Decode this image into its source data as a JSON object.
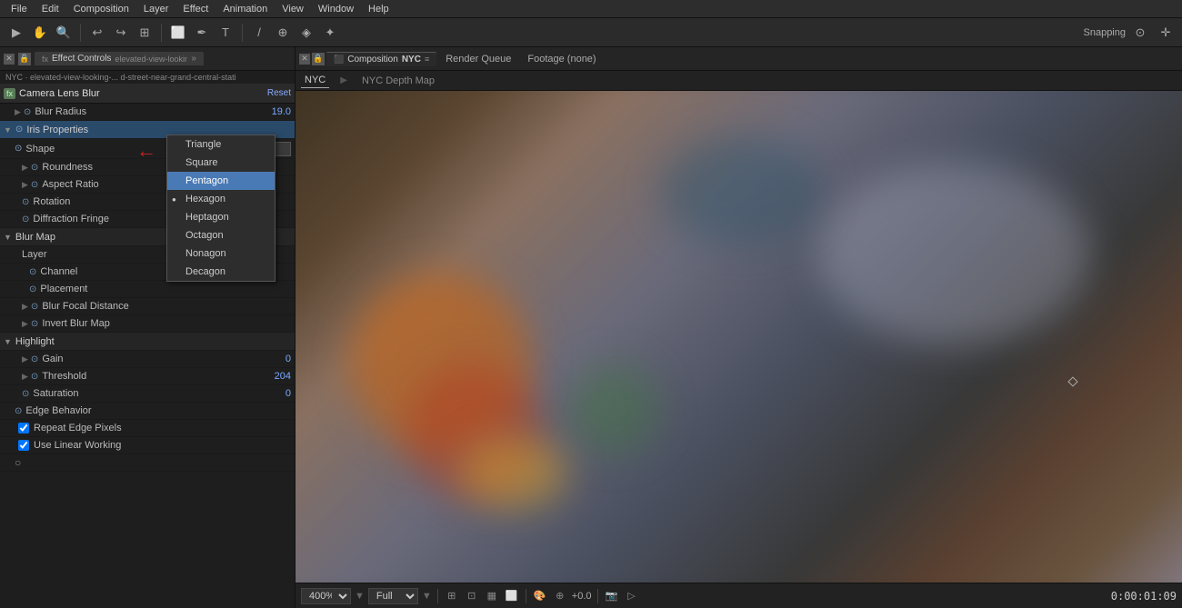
{
  "menubar": {
    "items": [
      "File",
      "Edit",
      "Composition",
      "Layer",
      "Effect",
      "Animation",
      "View",
      "Window",
      "Help"
    ]
  },
  "toolbar": {
    "snapping_label": "Snapping"
  },
  "left_panel": {
    "tab_label": "Effect Controls",
    "tab_file": "elevated-view-looking-... d-st",
    "layer_path": "NYC · elevated-view-looking-... d-street-near-grand-central-stati",
    "effect": {
      "name": "Camera Lens Blur",
      "reset_label": "Reset",
      "blur_radius_label": "Blur Radius",
      "blur_radius_value": "19.0",
      "iris_properties_label": "Iris Properties",
      "shape_label": "Shape",
      "shape_value": "Hexagon",
      "shape_options": [
        "Triangle",
        "Square",
        "Pentagon",
        "Hexagon",
        "Heptagon",
        "Octagon",
        "Nonagon",
        "Decagon"
      ],
      "shape_selected": "Hexagon",
      "shape_highlighted": "Pentagon",
      "roundness_label": "Roundness",
      "aspect_ratio_label": "Aspect Ratio",
      "rotation_label": "Rotation",
      "diffraction_fringe_label": "Diffraction Fringe",
      "blur_map_label": "Blur Map",
      "layer_label": "Layer",
      "channel_label": "Channel",
      "placement_label": "Placement",
      "blur_focal_distance_label": "Blur Focal Distance",
      "invert_blur_map_label": "Invert Blur Map",
      "highlight_label": "Highlight",
      "gain_label": "Gain",
      "gain_value": "0",
      "threshold_label": "Threshold",
      "threshold_value": "204",
      "saturation_label": "Saturation",
      "saturation_value": "0",
      "edge_behavior_label": "Edge Behavior",
      "repeat_edge_pixels_label": "Repeat Edge Pixels",
      "use_linear_working_label": "Use Linear Working",
      "repeat_edge_checked": true,
      "use_linear_checked": true
    }
  },
  "right_panel": {
    "tabs": [
      "Effect Controls",
      "Composition",
      "Render Queue",
      "Footage (none)"
    ],
    "active_tab": "Composition",
    "comp_name": "NYC",
    "subtabs": [
      "NYC",
      "NYC Depth Map"
    ],
    "active_subtab": "NYC",
    "zoom_value": "400%",
    "quality_value": "Full",
    "timecode": "0:00:01:09"
  }
}
